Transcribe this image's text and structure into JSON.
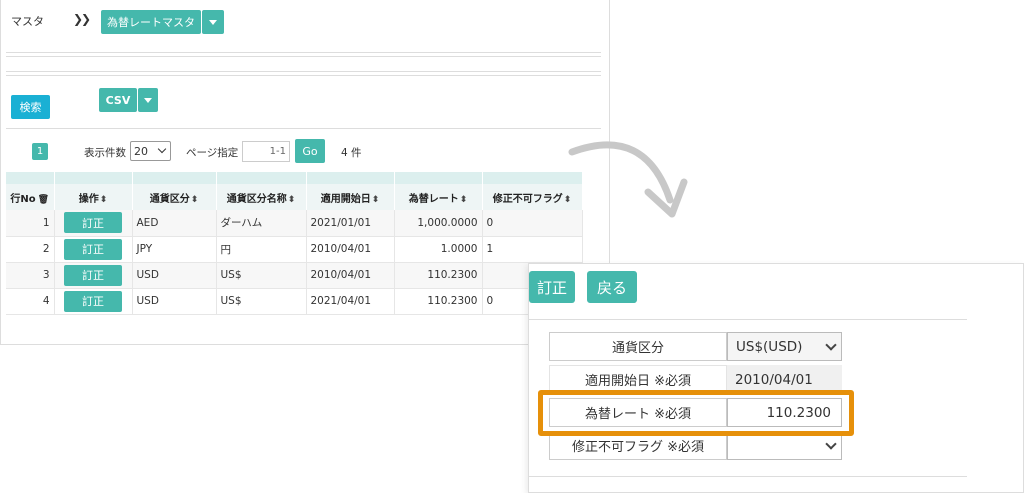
{
  "breadcrumb": {
    "root": "マスタ",
    "sep": "❯❯",
    "current": "為替レートマスタ"
  },
  "toolbar": {
    "search": "検索",
    "csv": "CSV"
  },
  "pager": {
    "page": "1",
    "per_page_label": "表示件数",
    "per_page": "20",
    "page_spec_label": "ページ指定",
    "page_input": "1-1",
    "go": "Go",
    "count": "4 件"
  },
  "table": {
    "headers": [
      "行No",
      "操作",
      "通貨区分",
      "通貨区分名称",
      "適用開始日",
      "為替レート",
      "修正不可フラグ"
    ],
    "edit_label": "訂正",
    "rows": [
      {
        "no": "1",
        "currency": "AED",
        "name": "ダーハム",
        "date": "2021/01/01",
        "rate": "1,000.0000",
        "flag": "0"
      },
      {
        "no": "2",
        "currency": "JPY",
        "name": "円",
        "date": "2010/04/01",
        "rate": "1.0000",
        "flag": "1"
      },
      {
        "no": "3",
        "currency": "USD",
        "name": "US$",
        "date": "2010/04/01",
        "rate": "110.2300",
        "flag": ""
      },
      {
        "no": "4",
        "currency": "USD",
        "name": "US$",
        "date": "2021/04/01",
        "rate": "110.2300",
        "flag": "0"
      }
    ]
  },
  "detail": {
    "edit_button": "訂正",
    "back_button": "戻る",
    "fields": [
      {
        "label": "通貨区分",
        "value": "US$(USD)"
      },
      {
        "label": "適用開始日 ※必須",
        "value": "2010/04/01"
      },
      {
        "label": "為替レート ※必須",
        "value": "110.2300"
      },
      {
        "label": "修正不可フラグ ※必須",
        "value": ""
      }
    ]
  },
  "colors": {
    "accent": "#45b8ac",
    "search_button": "#1ab0d4",
    "highlight": "#e6900a",
    "arrow": "#c8c8c8"
  }
}
